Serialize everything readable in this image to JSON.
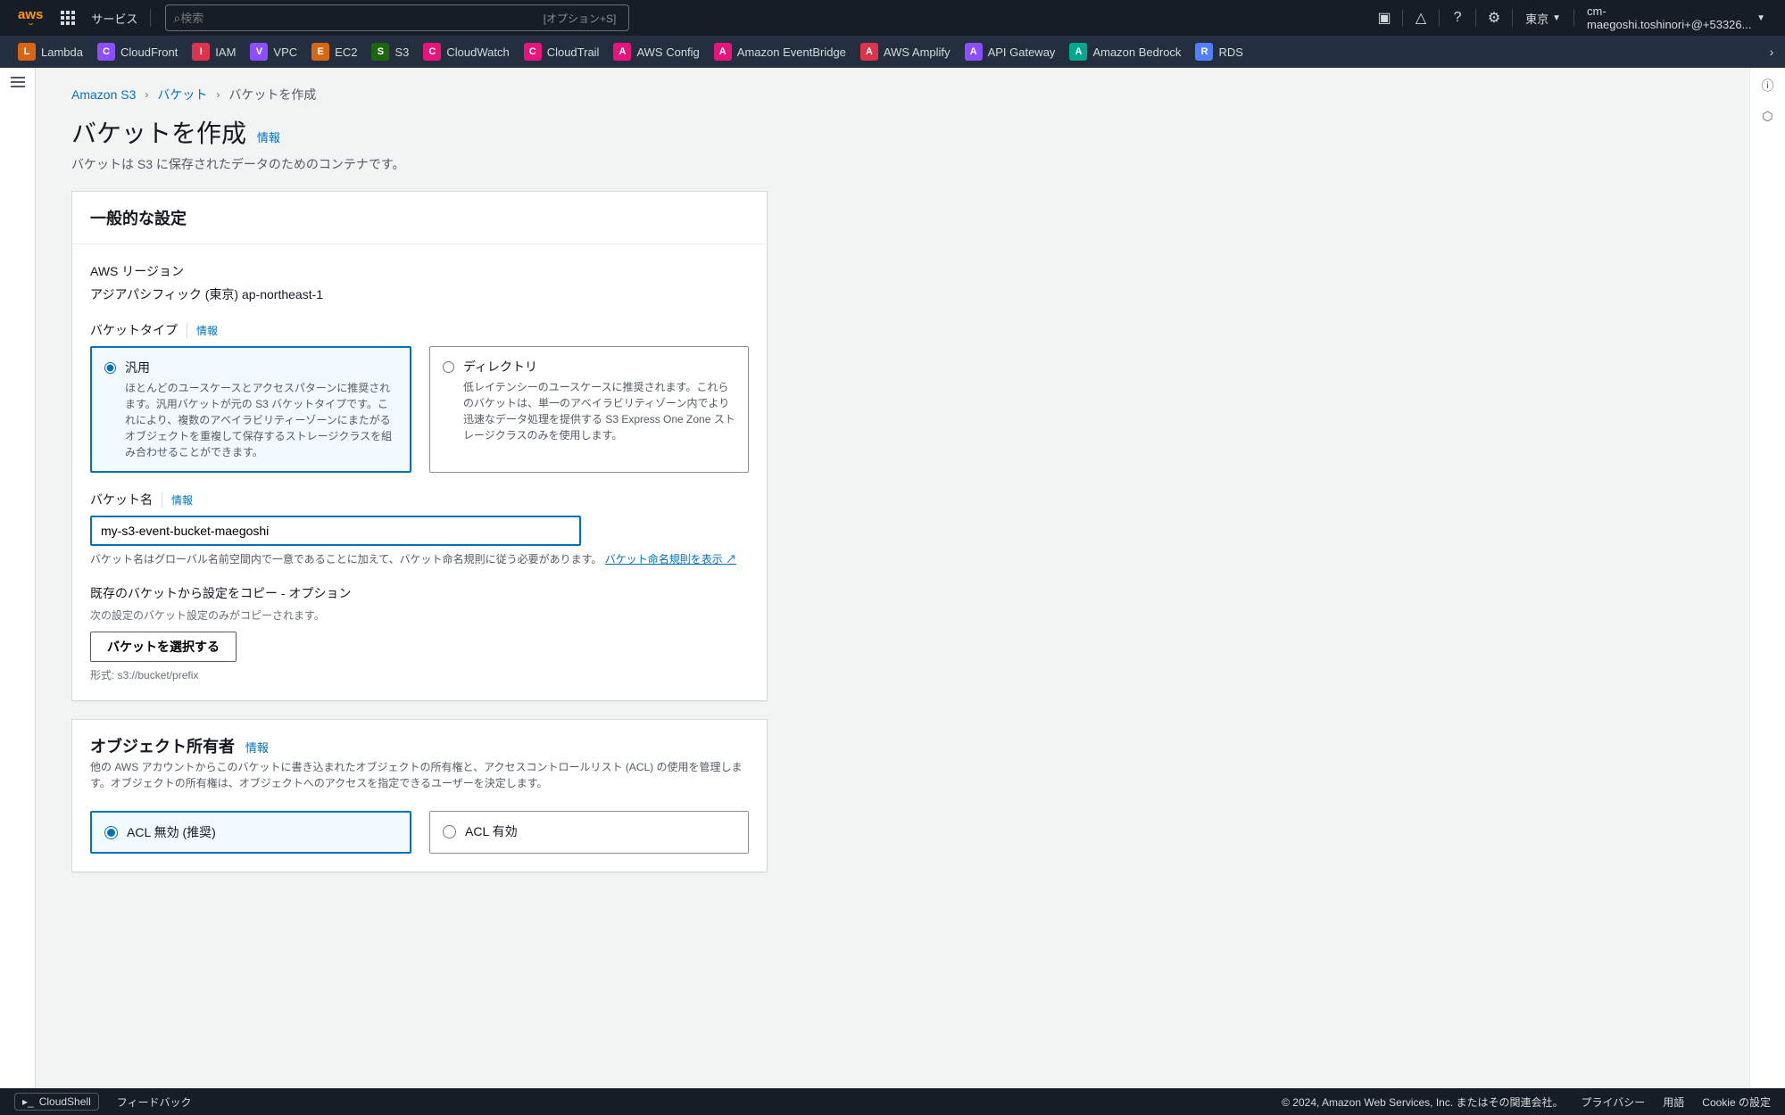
{
  "nav": {
    "logo": "aws",
    "services_label": "サービス",
    "search_placeholder": "検索",
    "search_hint": "[オプション+S]",
    "region": "東京",
    "account": "cm-maegoshi.toshinori+@+53326..."
  },
  "shortcuts": [
    {
      "label": "Lambda",
      "color": "#d86613"
    },
    {
      "label": "CloudFront",
      "color": "#8c4fff"
    },
    {
      "label": "IAM",
      "color": "#dd344c"
    },
    {
      "label": "VPC",
      "color": "#8c4fff"
    },
    {
      "label": "EC2",
      "color": "#d86613"
    },
    {
      "label": "S3",
      "color": "#1b660f"
    },
    {
      "label": "CloudWatch",
      "color": "#e7157b"
    },
    {
      "label": "CloudTrail",
      "color": "#e7157b"
    },
    {
      "label": "AWS Config",
      "color": "#e7157b"
    },
    {
      "label": "Amazon EventBridge",
      "color": "#e7157b"
    },
    {
      "label": "AWS Amplify",
      "color": "#dd344c"
    },
    {
      "label": "API Gateway",
      "color": "#8c4fff"
    },
    {
      "label": "Amazon Bedrock",
      "color": "#01a88d"
    },
    {
      "label": "RDS",
      "color": "#527fff"
    }
  ],
  "breadcrumb": {
    "root": "Amazon S3",
    "buckets": "バケット",
    "current": "バケットを作成"
  },
  "page": {
    "title": "バケットを作成",
    "info": "情報",
    "desc": "バケットは S3 に保存されたデータのためのコンテナです。"
  },
  "general": {
    "heading": "一般的な設定",
    "region_label": "AWS リージョン",
    "region_value": "アジアパシフィック (東京) ap-northeast-1",
    "type_label": "バケットタイプ",
    "type_info": "情報",
    "type_general_title": "汎用",
    "type_general_desc": "ほとんどのユースケースとアクセスパターンに推奨されます。汎用バケットが元の S3 バケットタイプです。これにより、複数のアベイラビリティーゾーンにまたがるオブジェクトを重複して保存するストレージクラスを組み合わせることができます。",
    "type_dir_title": "ディレクトリ",
    "type_dir_desc": "低レイテンシーのユースケースに推奨されます。これらのバケットは、単一のアベイラビリティゾーン内でより迅速なデータ処理を提供する S3 Express One Zone ストレージクラスのみを使用します。",
    "name_label": "バケット名",
    "name_info": "情報",
    "name_value": "my-s3-event-bucket-maegoshi",
    "name_help": "バケット名はグローバル名前空間内で一意であることに加えて、バケット命名規則に従う必要があります。",
    "name_help_link": "バケット命名規則を表示",
    "copy_label": "既存のバケットから設定をコピー - オプション",
    "copy_sub": "次の設定のバケット設定のみがコピーされます。",
    "copy_btn": "バケットを選択する",
    "copy_format": "形式: s3://bucket/prefix"
  },
  "owner": {
    "heading": "オブジェクト所有者",
    "info": "情報",
    "desc": "他の AWS アカウントからこのバケットに書き込まれたオブジェクトの所有権と、アクセスコントロールリスト (ACL) の使用を管理します。オブジェクトの所有権は、オブジェクトへのアクセスを指定できるユーザーを決定します。",
    "acl_disabled": "ACL 無効 (推奨)",
    "acl_enabled": "ACL 有効"
  },
  "footer": {
    "cloudshell": "CloudShell",
    "feedback": "フィードバック",
    "copyright": "© 2024, Amazon Web Services, Inc. またはその関連会社。",
    "privacy": "プライバシー",
    "terms": "用語",
    "cookies": "Cookie の設定"
  }
}
